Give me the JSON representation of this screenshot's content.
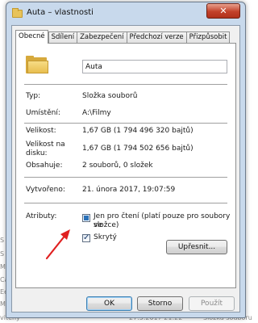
{
  "background": {
    "left_fragments": [
      "S",
      "S",
      "M",
      "Ca",
      "Ee",
      "Ma",
      "reny"
    ],
    "bottom_left": "viteny",
    "bottom_mid": "27.5.2017 21:22",
    "bottom_right": "Složka souboru"
  },
  "window": {
    "title": "Auta – vlastnosti",
    "close_label": "✕"
  },
  "tabs": [
    "Obecné",
    "Sdílení",
    "Zabezpečení",
    "Předchozí verze",
    "Přizpůsobit"
  ],
  "general": {
    "name_value": "Auta",
    "rows": [
      {
        "label": "Typ:",
        "value": "Složka souborů"
      },
      {
        "label": "Umístění:",
        "value": "A:\\Filmy"
      },
      {
        "label": "Velikost:",
        "value": "1,67 GB (1 794 496 320 bajtů)"
      },
      {
        "label_line1": "Velikost na",
        "label_line2": "disku:",
        "value": "1,67 GB (1 794 502 656 bajtů)"
      },
      {
        "label": "Obsahuje:",
        "value": "2 souborů, 0 složek"
      },
      {
        "label": "Vytvořeno:",
        "value": "21. února 2017, 19:07:59"
      }
    ],
    "attributes_label": "Atributy:",
    "readonly_line1": "Jen pro čtení (platí pouze pro soubory ve",
    "readonly_line2": "složce)",
    "hidden_label": "Skrytý",
    "hidden_checked": true,
    "advanced_button": "Upřesnit..."
  },
  "buttons": {
    "ok": "OK",
    "cancel": "Storno",
    "apply": "Použít"
  },
  "colors": {
    "arrow": "#e02020",
    "frame": "#c8d9ec"
  }
}
